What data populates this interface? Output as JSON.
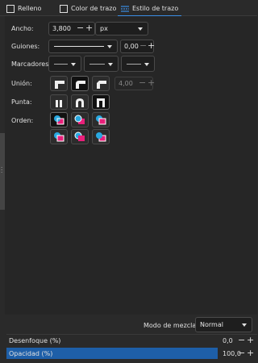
{
  "tabs": [
    {
      "label": "Relleno"
    },
    {
      "label": "Color de trazo"
    },
    {
      "label": "Estilo de trazo"
    }
  ],
  "width": {
    "label": "Ancho:",
    "value": "3,800",
    "unit": "px"
  },
  "dashes": {
    "label": "Guiones:",
    "offset": "0,00"
  },
  "markers": {
    "label": "Marcadores:"
  },
  "join": {
    "label": "Unión:",
    "limit": "4,00"
  },
  "cap": {
    "label": "Punta:"
  },
  "order": {
    "label": "Orden:"
  },
  "blend": {
    "label": "Modo de mezcla:",
    "value": "Normal"
  },
  "blur": {
    "label": "Desenfoque (%)",
    "value": "0,0"
  },
  "opacity": {
    "label": "Opacidad (%)",
    "value": "100,0",
    "fraction": 1.0
  },
  "colors": {
    "accent": "#3a8ee6",
    "order_blue": "#29a8e0",
    "order_pink": "#e8207a"
  },
  "icons": [
    "checkbox-icon",
    "stroke-style-icon",
    "minus-icon",
    "plus-icon",
    "chevron-down-icon",
    "join-miter-icon",
    "join-round-icon",
    "join-bevel-icon",
    "cap-butt-icon",
    "cap-round-icon",
    "cap-square-icon",
    "paint-order-icon"
  ]
}
